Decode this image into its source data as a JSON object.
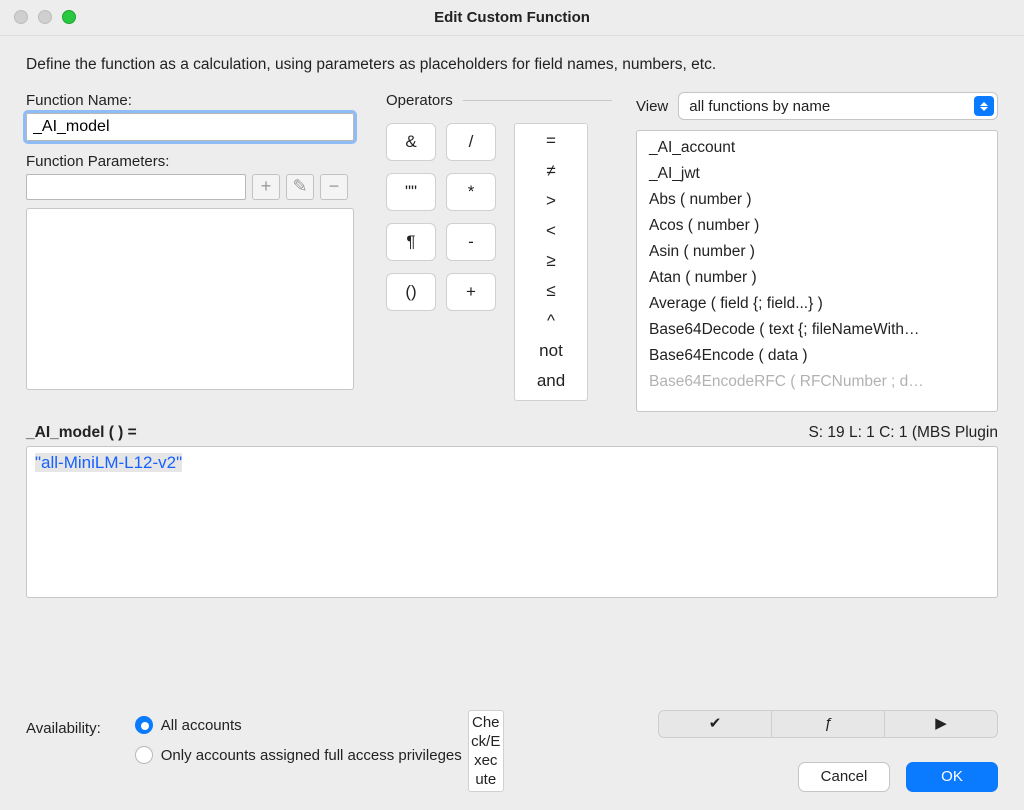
{
  "window": {
    "title": "Edit Custom Function"
  },
  "intro": "Define the function as a calculation, using parameters as placeholders for field names, numbers, etc.",
  "labels": {
    "function_name": "Function Name:",
    "function_parameters": "Function Parameters:",
    "operators": "Operators",
    "view": "View",
    "availability": "Availability:"
  },
  "fields": {
    "function_name": "_AI_model",
    "param_input": ""
  },
  "param_buttons": {
    "add": "+",
    "edit": "✎",
    "remove": "−"
  },
  "ops_col1": [
    "&",
    "\"\"",
    "¶",
    "()"
  ],
  "ops_col2": [
    "/",
    "*",
    "-",
    "+"
  ],
  "ops_col3": [
    "=",
    "≠",
    ">",
    "<",
    "≥",
    "≤",
    "^",
    "not",
    "and"
  ],
  "view_select": "all functions by name",
  "functions": [
    "_AI_account",
    "_AI_jwt",
    "Abs ( number )",
    "Acos ( number )",
    "Asin ( number )",
    "Atan ( number )",
    "Average ( field {; field...} )",
    "Base64Decode ( text {; fileNameWith…",
    "Base64Encode ( data )",
    "Base64EncodeRFC ( RFCNumber ; d…"
  ],
  "signature": "_AI_model (  ) =",
  "status": "S: 19 L: 1 C: 1 (MBS Plugin",
  "calc_literal": "\"all-MiniLM-L12-v2\"",
  "availability": {
    "all": "All accounts",
    "restricted": "Only accounts assigned full access privileges"
  },
  "vertbox": "Check/Execute",
  "segments": {
    "check": "✔",
    "fx": "ƒ",
    "play": "▶"
  },
  "buttons": {
    "cancel": "Cancel",
    "ok": "OK"
  }
}
